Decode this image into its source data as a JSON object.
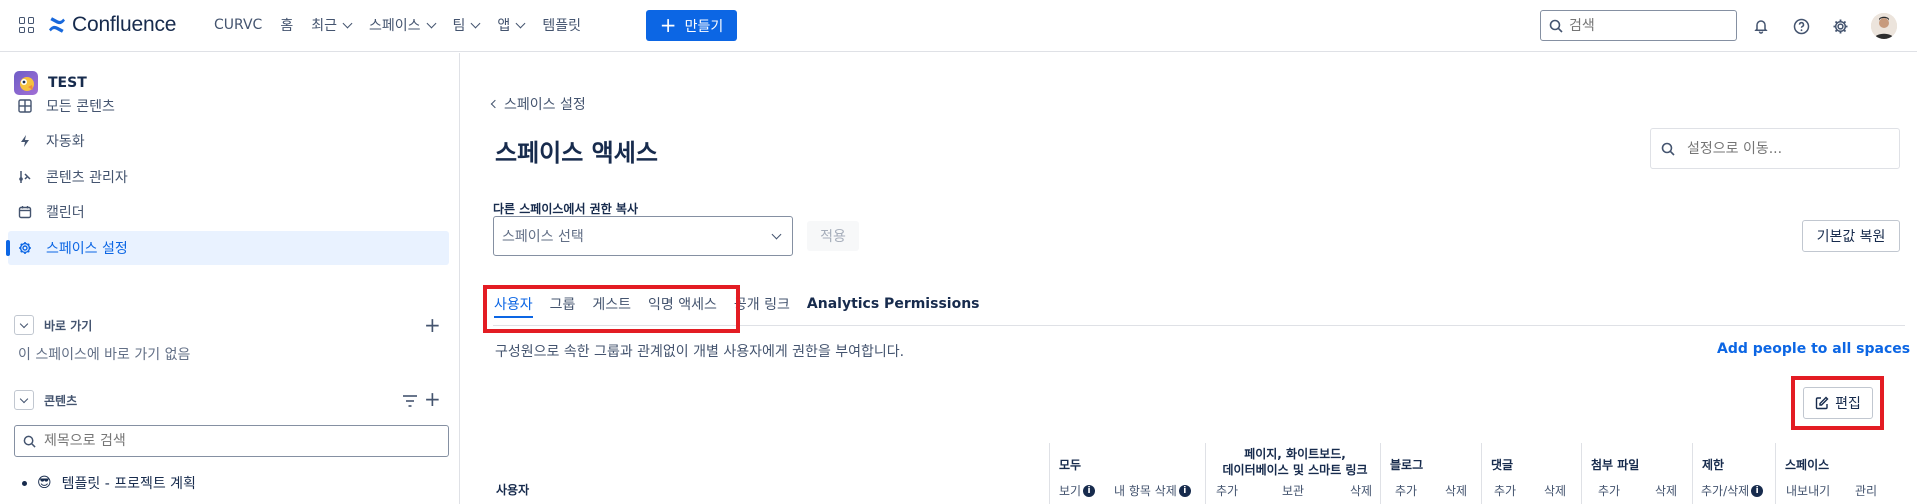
{
  "topnav": {
    "logo": "Confluence",
    "items": [
      {
        "label": "CURVC",
        "has_chevron": false
      },
      {
        "label": "홈",
        "has_chevron": false
      },
      {
        "label": "최근",
        "has_chevron": true
      },
      {
        "label": "스페이스",
        "has_chevron": true
      },
      {
        "label": "팀",
        "has_chevron": true
      },
      {
        "label": "앱",
        "has_chevron": true
      },
      {
        "label": "템플릿",
        "has_chevron": false
      }
    ],
    "create_label": "만들기",
    "search_placeholder": "검색",
    "icons": [
      "app-switcher-icon",
      "notification-bell-icon",
      "help-icon",
      "settings-gear-icon",
      "user-avatar"
    ]
  },
  "sidebar": {
    "space_name": "TEST",
    "items": [
      {
        "label": "모든 콘텐츠",
        "icon": "grid-icon",
        "active": false
      },
      {
        "label": "자동화",
        "icon": "lightning-icon",
        "active": false
      },
      {
        "label": "콘텐츠 관리자",
        "icon": "content-manager-icon",
        "active": false
      },
      {
        "label": "캘린더",
        "icon": "calendar-icon",
        "active": false
      },
      {
        "label": "스페이스 설정",
        "icon": "gear-icon",
        "active": true
      }
    ],
    "shortcuts": {
      "title": "바로 가기",
      "empty": "이 스페이스에 바로 가기 없음"
    },
    "content": {
      "title": "콘텐츠",
      "search_placeholder": "제목으로 검색"
    },
    "tree": [
      {
        "emoji": "😎",
        "label": "템플릿 - 프로젝트 계획"
      }
    ]
  },
  "main": {
    "back_label": "스페이스 설정",
    "title": "스페이스 액세스",
    "goto_placeholder": "설정으로 이동...",
    "copy_label": "다른 스페이스에서 권한 복사",
    "select_placeholder": "스페이스 선택",
    "apply_label": "적용",
    "restore_label": "기본값 복원",
    "tabs": [
      {
        "label": "사용자",
        "active": true
      },
      {
        "label": "그룹",
        "active": false
      },
      {
        "label": "게스트",
        "active": false
      },
      {
        "label": "익명 액세스",
        "active": false
      },
      {
        "label": "공개 링크",
        "active": false
      },
      {
        "label": "Analytics Permissions",
        "active": false
      }
    ],
    "description": "구성원으로 속한 그룹과 관계없이 개별 사용자에게 권한을 부여합니다.",
    "add_all_label": "Add people to all spaces",
    "edit_label": "편집"
  },
  "table": {
    "user_col": "사용자",
    "groups": [
      {
        "title": "모두",
        "subs": [
          {
            "label": "보기",
            "info": true
          },
          {
            "label": "내 항목 삭제",
            "info": true
          }
        ]
      },
      {
        "title_lines": [
          "페이지, 화이트보드,",
          "데이터베이스 및 스마트 링크"
        ],
        "subs": [
          {
            "label": "추가",
            "info": false
          },
          {
            "label": "보관",
            "info": false
          },
          {
            "label": "삭제",
            "info": false
          }
        ]
      },
      {
        "title": "블로그",
        "subs": [
          {
            "label": "추가",
            "info": false
          },
          {
            "label": "삭제",
            "info": false
          }
        ]
      },
      {
        "title": "댓글",
        "subs": [
          {
            "label": "추가",
            "info": false
          },
          {
            "label": "삭제",
            "info": false
          }
        ]
      },
      {
        "title": "첨부 파일",
        "subs": [
          {
            "label": "추가",
            "info": false
          },
          {
            "label": "삭제",
            "info": false
          }
        ]
      },
      {
        "title": "제한",
        "subs": [
          {
            "label": "추가/삭제",
            "info": true
          }
        ]
      },
      {
        "title": "스페이스",
        "subs": [
          {
            "label": "내보내기",
            "info": false
          },
          {
            "label": "관리",
            "info": false
          }
        ]
      }
    ]
  },
  "colors": {
    "accent": "#0c66e4",
    "highlight": "#e31c23",
    "text": "#172b4d",
    "subtle": "#44546f"
  }
}
